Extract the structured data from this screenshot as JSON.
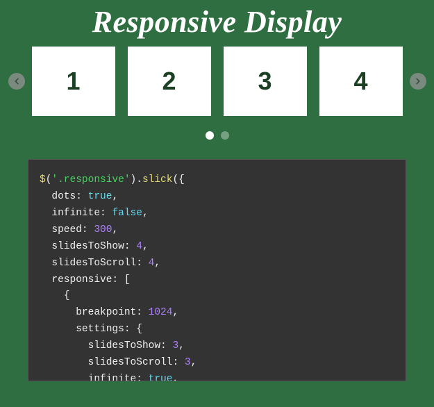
{
  "title": "Responsive Display",
  "slides": [
    "1",
    "2",
    "3",
    "4"
  ],
  "dots": {
    "count": 2,
    "active": 0
  },
  "code": {
    "selector": "'.responsive'",
    "method": "slick",
    "lines": [
      {
        "key": "dots",
        "val": "true",
        "type": "bool",
        "comma": true
      },
      {
        "key": "infinite",
        "val": "false",
        "type": "bool",
        "comma": true
      },
      {
        "key": "speed",
        "val": "300",
        "type": "num",
        "comma": true
      },
      {
        "key": "slidesToShow",
        "val": "4",
        "type": "num",
        "comma": true
      },
      {
        "key": "slidesToScroll",
        "val": "4",
        "type": "num",
        "comma": true
      }
    ],
    "responsive_key": "responsive",
    "breakpoint_key": "breakpoint",
    "breakpoint_val": "1024",
    "settings_key": "settings",
    "inner": [
      {
        "key": "slidesToShow",
        "val": "3",
        "type": "num",
        "comma": true
      },
      {
        "key": "slidesToScroll",
        "val": "3",
        "type": "num",
        "comma": true
      },
      {
        "key": "infinite",
        "val": "true",
        "type": "bool",
        "comma": true
      }
    ]
  }
}
